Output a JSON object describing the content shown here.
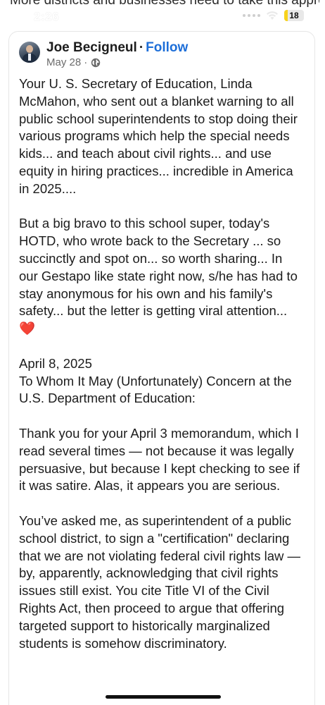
{
  "background_post": {
    "text": "More districts and businesses need to take this approach"
  },
  "status_bar": {
    "time": "2:26",
    "battery": "18"
  },
  "post": {
    "author_name": "Joe Becigneul",
    "separator": "·",
    "follow_label": "Follow",
    "date": "May 28",
    "meta_separator": "·",
    "paragraphs": [
      "Your U. S. Secretary of Education, Linda McMahon, who sent out a blanket warning to all public school superintendents to stop doing their various programs which help the special needs kids... and teach about civil rights... and use equity in hiring practices... incredible in America in 2025....",
      "But a big bravo to this school super, today's HOTD, who wrote back to the Secretary ... so succinctly and spot on... so worth sharing... In our Gestapo like state right now, s/he has had to stay anonymous for his own and his family's safety... but the letter is getting viral attention...",
      "April 8, 2025",
      "To Whom It May (Unfortunately) Concern at the U.S. Department of Education:",
      "Thank you for your April 3 memorandum, which I read several times — not because it was legally persuasive, but because I kept checking to see if it was satire. Alas, it appears you are serious.",
      "You’ve asked me, as superintendent of a public school district, to sign a \"certification\" declaring that we are not violating federal civil rights law — by, apparently, acknowledging that civil rights issues still exist. You cite Title VI of the Civil Rights Act, then proceed to argue that offering targeted support to historically marginalized students is somehow discriminatory."
    ],
    "heart_emoji": "❤️"
  },
  "colors": {
    "link": "#1d6ed8",
    "heart": "#e0201b",
    "battery_fill": "#f7d21c"
  }
}
